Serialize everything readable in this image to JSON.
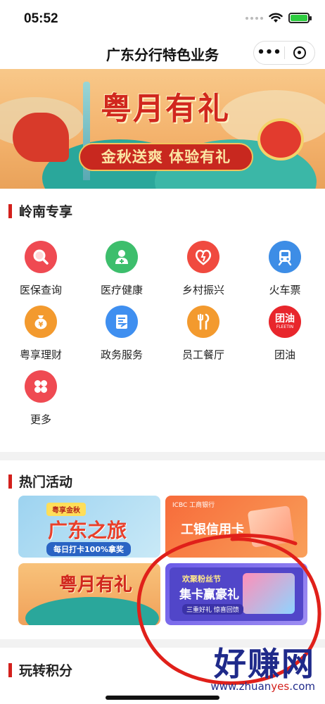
{
  "status_bar": {
    "time": "05:52"
  },
  "nav": {
    "title": "广东分行特色业务",
    "more": "•••"
  },
  "banner": {
    "title": "粤月有礼",
    "subtitle": "金秋送爽 体验有礼"
  },
  "lingnan": {
    "title": "岭南专享",
    "items": [
      {
        "label": "医保查询",
        "icon": "search-icon",
        "color": "#ef4a52"
      },
      {
        "label": "医疗健康",
        "icon": "doctor-icon",
        "color": "#3dbe6c"
      },
      {
        "label": "乡村振兴",
        "icon": "heart-icon",
        "color": "#f04a3f"
      },
      {
        "label": "火车票",
        "icon": "train-icon",
        "color": "#3d8de6"
      },
      {
        "label": "粤享理财",
        "icon": "money-bag-icon",
        "color": "#f39a2e"
      },
      {
        "label": "政务服务",
        "icon": "government-icon",
        "color": "#3f8ff0"
      },
      {
        "label": "员工餐厅",
        "icon": "utensils-icon",
        "color": "#f39a2e"
      },
      {
        "label": "团油",
        "icon": "tuanyou-logo-icon",
        "color": "#e8262c",
        "badge_text": "团油",
        "badge_sub": "FLEETIN"
      },
      {
        "label": "更多",
        "icon": "more-grid-icon",
        "color": "#ef4a52"
      }
    ]
  },
  "hot": {
    "title": "热门活动",
    "cards": [
      {
        "tag": "粤享金秋",
        "main": "广东之旅",
        "sub": "每日打卡100%拿奖"
      },
      {
        "brand": "ICBC 工商银行",
        "main": "工银信用卡"
      },
      {
        "main": "粤月有礼"
      },
      {
        "top": "欢聚粉丝节",
        "main": "集卡赢豪礼",
        "sub": "三重好礼 惊喜回馈"
      }
    ]
  },
  "points": {
    "title": "玩转积分"
  },
  "watermark": {
    "big": "好赚网",
    "small_pre": "www.zhuan",
    "small_hl": "yes",
    "small_post": ".com"
  },
  "colors": {
    "accent": "#d3201c",
    "watermark": "#1f2a8a",
    "annotation": "#e0201a"
  }
}
